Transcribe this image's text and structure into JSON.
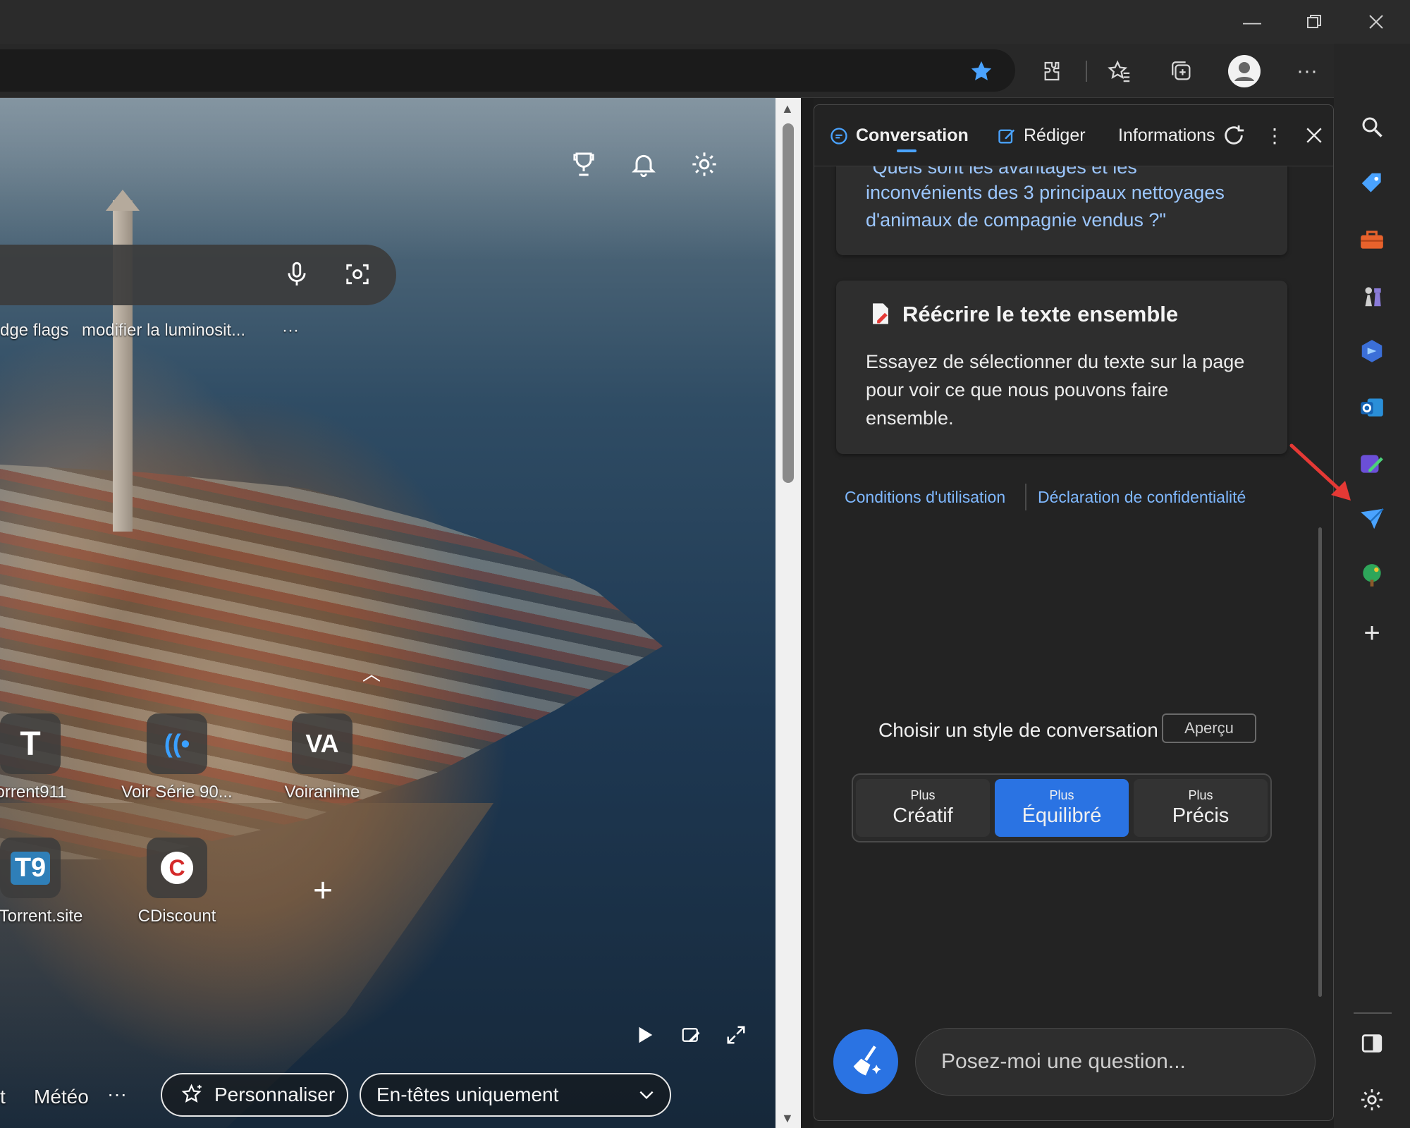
{
  "window": {
    "minimize_icon": "minimize-icon",
    "restore_icon": "restore-icon",
    "close_icon": "close-icon"
  },
  "toolbar": {
    "icons": [
      "favorite-star-icon",
      "extensions-icon",
      "favorites-icon",
      "collections-icon",
      "profile-icon",
      "more-icon",
      "bing-chat-icon"
    ]
  },
  "ntp": {
    "quick_links": [
      "dge flags",
      "modifier la luminosit...",
      "···"
    ],
    "tiles_row1": [
      {
        "label": "orrent911",
        "glyph": "T"
      },
      {
        "label": "Voir Série 90...",
        "glyph": "((•"
      },
      {
        "label": "Voiranime",
        "glyph": "VA"
      }
    ],
    "tiles_row2": [
      {
        "label": "Torrent.site",
        "glyph": "T9"
      },
      {
        "label": "CDiscount",
        "glyph": "C"
      }
    ],
    "add_tile": "+",
    "bottom": {
      "left_fragment": "t",
      "weather": "Météo",
      "more": "···",
      "personalize": "Personnaliser",
      "headings": "En-têtes uniquement"
    }
  },
  "panel": {
    "tabs": {
      "conversation": "Conversation",
      "compose": "Rédiger",
      "insights": "Informations"
    },
    "card1": {
      "clipped_line": "\"Quels sont les avantages et les",
      "line2": "inconvénients des 3 principaux nettoyages",
      "line3": "d'animaux de compagnie vendus ?\""
    },
    "card2": {
      "title": "Réécrire le texte ensemble",
      "body_lines": [
        "Essayez de sélectionner du texte sur la page",
        "pour voir ce que nous pouvons faire",
        "ensemble."
      ]
    },
    "links": {
      "terms": "Conditions d'utilisation",
      "privacy": "Déclaration de confidentialité"
    },
    "style": {
      "label": "Choisir un style de conversation",
      "badge": "Aperçu",
      "options": [
        {
          "small": "Plus",
          "big": "Créatif"
        },
        {
          "small": "Plus",
          "big": "Équilibré"
        },
        {
          "small": "Plus",
          "big": "Précis"
        }
      ],
      "selected": 1
    },
    "input_placeholder": "Posez-moi une question..."
  },
  "sidebar": {
    "icons": [
      "search-icon",
      "tag-icon",
      "toolbox-icon",
      "chess-icon",
      "copilot-icon",
      "outlook-icon",
      "designer-icon",
      "send-icon",
      "tree-icon",
      "add-icon",
      "split-screen-icon",
      "settings-icon"
    ]
  },
  "colors": {
    "accent": "#2a73e3",
    "link": "#7fb8ff",
    "annotation_arrow": "#e53935"
  }
}
